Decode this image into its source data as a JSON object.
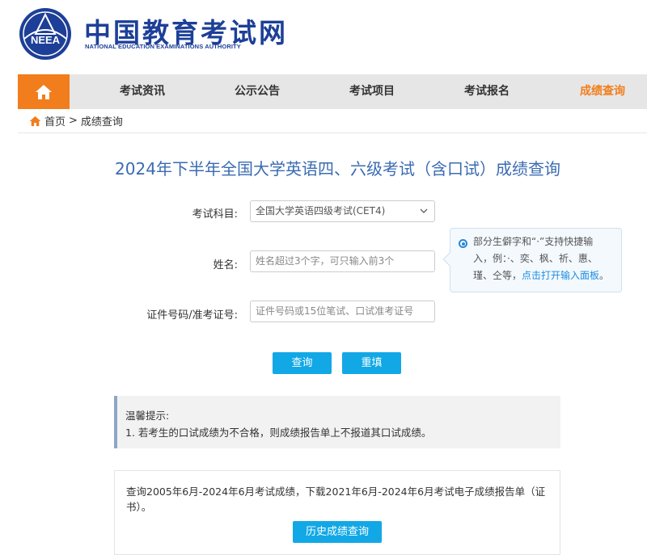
{
  "header": {
    "logo_text": "NEEA",
    "title": "中国教育考试网",
    "subtitle": "NATIONAL EDUCATION EXAMINATIONS AUTHORITY"
  },
  "nav": {
    "items": [
      {
        "label": "考试资讯"
      },
      {
        "label": "公示公告"
      },
      {
        "label": "考试项目"
      },
      {
        "label": "考试报名"
      },
      {
        "label": "成绩查询"
      }
    ]
  },
  "breadcrumb": {
    "home": "首页",
    "separator": ">",
    "current": "成绩查询"
  },
  "page_title": "2024年下半年全国大学英语四、六级考试（含口试）成绩查询",
  "form": {
    "subject_label": "考试科目:",
    "subject_value": "全国大学英语四级考试(CET4)",
    "name_label": "姓名:",
    "name_placeholder": "姓名超过3个字，可只输入前3个",
    "id_label": "证件号码/准考证号:",
    "id_placeholder": "证件号码或15位笔试、口试准考证号",
    "query_button": "查询",
    "reset_button": "重填"
  },
  "tip": {
    "line1": "部分生僻字和“·”支持快捷输",
    "line2": "入，例：·、奕、枫、祈、惠、",
    "line3_text": "瑾、仝等，",
    "line3_link": "点击打开输入面板",
    "line3_end": "。"
  },
  "notice": {
    "title": "温馨提示:",
    "item1": "1. 若考生的口试成绩为不合格，则成绩报告单上不报道其口试成绩。"
  },
  "history": {
    "text": "查询2005年6月-2024年6月考试成绩，下载2021年6月-2024年6月考试电子成绩报告单（证书）。",
    "button": "历史成绩查询"
  },
  "colors": {
    "brand_blue": "#1d3f98",
    "accent_orange": "#f27d1c",
    "button_blue": "#12a8e6",
    "title_blue": "#3a6bb2"
  }
}
